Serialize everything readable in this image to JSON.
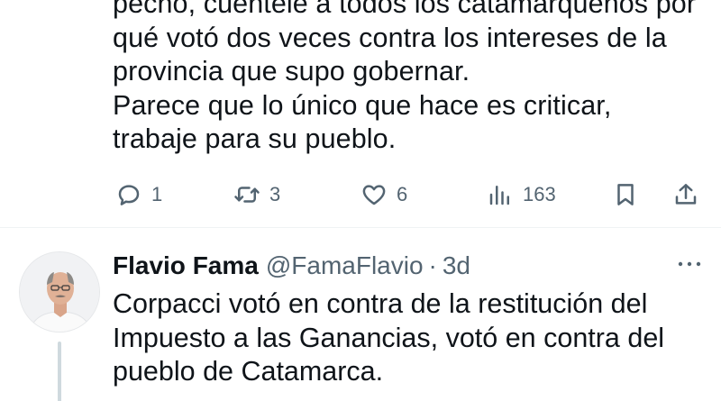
{
  "tweet_top": {
    "lines": [
      "pecho, cuentele a todos los catamarqueños por",
      "qué votó dos veces contra los intereses de la",
      "provincia que supo gobernar.",
      "Parece que lo único que hace es criticar,",
      "trabaje para su pueblo."
    ],
    "actions": {
      "reply_count": "1",
      "retweet_count": "3",
      "like_count": "6",
      "views_count": "163"
    }
  },
  "tweet_bottom": {
    "author_name": "Flavio Fama",
    "handle": "@FamaFlavio",
    "separator": "·",
    "time": "3d",
    "lines": [
      "Corpacci votó en contra de la restitución del",
      "Impuesto a las Ganancias, votó en contra del",
      "pueblo de Catamarca."
    ]
  },
  "icons": {
    "reply": "reply-icon",
    "retweet": "retweet-icon",
    "like": "heart-icon",
    "views": "views-icon",
    "bookmark": "bookmark-icon",
    "share": "share-icon",
    "more": "more-icon"
  },
  "colors": {
    "text": "#0f1419",
    "secondary": "#536471",
    "divider": "#eff3f4",
    "thread_line": "#cfd9de"
  }
}
